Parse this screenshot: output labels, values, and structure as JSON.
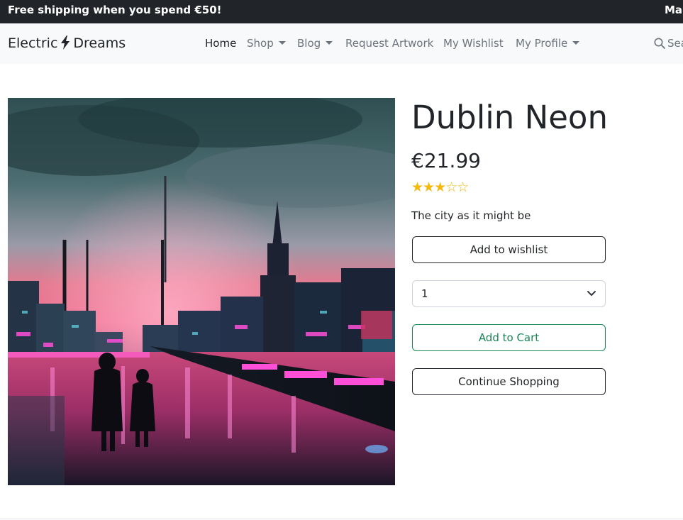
{
  "promo": {
    "messages": [
      "Free shipping when you spend €50!",
      "Mar"
    ]
  },
  "navbar": {
    "brand_left": "Electric",
    "brand_right": "Dreams",
    "brand_icon": "lightning-bolt-icon",
    "items": [
      {
        "label": "Home",
        "active": true,
        "dropdown": false
      },
      {
        "label": "Shop",
        "active": false,
        "dropdown": true
      },
      {
        "label": "Blog",
        "active": false,
        "dropdown": true
      },
      {
        "label": "Request Artwork",
        "active": false,
        "dropdown": false
      },
      {
        "label": "My Wishlist",
        "active": false,
        "dropdown": false
      },
      {
        "label": "My Profile",
        "active": false,
        "dropdown": true
      }
    ],
    "search_label": "Sea"
  },
  "product": {
    "title": "Dublin Neon",
    "price": "€21.99",
    "rating": 3,
    "rating_max": 5,
    "stars_display": "★★★☆☆",
    "description": "The city as it might be",
    "wishlist_label": "Add to wishlist",
    "quantity": "1",
    "add_to_cart_label": "Add to Cart",
    "continue_label": "Continue Shopping"
  },
  "colors": {
    "promo_bg": "#212529",
    "navbar_bg": "#f8f9fa",
    "star": "#f5b80f",
    "success": "#198754"
  }
}
